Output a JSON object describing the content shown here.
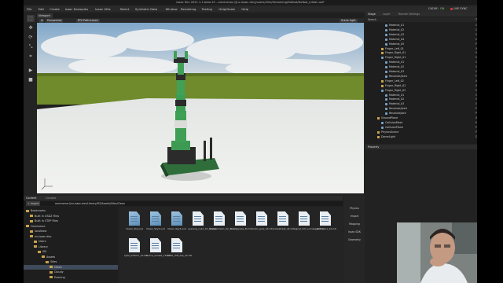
{
  "window": {
    "title": "Isaac Sim 2021.1.1-beta.10 - omniverse://[nv-isaac-dev]/users/hlliu/Streaming/Dofbot/Dofbot_initial.usd*"
  },
  "menu": {
    "items": [
      "File",
      "Edit",
      "Create",
      "Isaac Examples",
      "Isaac Utils",
      "Select",
      "Synthetic Data",
      "Window",
      "Rendering",
      "Testing",
      "Help/Goals",
      "Help"
    ],
    "cache_label": "CACHE:",
    "cache_state": "ON",
    "live_sync": "LIVE SYNC"
  },
  "viewport": {
    "tab": "Viewport",
    "perspective": "Perspective",
    "rtx": "RTX Path-traced",
    "camera": "Scene Light"
  },
  "tools": [
    "select-icon",
    "move-icon",
    "rotate-icon",
    "scale-icon",
    "snap-icon",
    "play-icon",
    "stop-icon"
  ],
  "content": {
    "tabs": [
      "Content",
      "Console"
    ],
    "import_label": "Import",
    "path": "omniverse://nv-isaac-dev/Library/ISS/Assets/Sites/Clean",
    "tree": [
      {
        "label": "Bookmarks",
        "indent": 0
      },
      {
        "label": "Built In USDZ Files",
        "indent": 1
      },
      {
        "label": "Built In STEP Files",
        "indent": 1
      },
      {
        "label": "Omniverse",
        "indent": 0
      },
      {
        "label": "localhost",
        "indent": 1
      },
      {
        "label": "nv-isaac-dev",
        "indent": 1
      },
      {
        "label": "Users",
        "indent": 2
      },
      {
        "label": "Library",
        "indent": 2
      },
      {
        "label": "ISS",
        "indent": 3
      },
      {
        "label": "Assets",
        "indent": 4
      },
      {
        "label": "Sites",
        "indent": 5
      },
      {
        "label": "Clean",
        "indent": 6,
        "selected": true
      },
      {
        "label": "Cloudy",
        "indent": 6
      },
      {
        "label": "Evening",
        "indent": 6
      }
    ],
    "files": [
      {
        "label": "Clean_Sky.usd",
        "kind": "blue"
      },
      {
        "label": "Clean_Sky2.usd",
        "kind": "blue"
      },
      {
        "label": "Clean_Sky3.usd",
        "kind": "blue"
      },
      {
        "label": "evening_road_01_4k.hdr",
        "kind": "white"
      },
      {
        "label": "kloppenheim_02_4k.hdr",
        "kind": "white"
      },
      {
        "label": "noon_grass_4k.hdr",
        "kind": "white"
      },
      {
        "label": "rustic_gras_4k.hdr",
        "kind": "white"
      },
      {
        "label": "snowstreet_4k.hdr",
        "kind": "white"
      },
      {
        "label": "signal_hill_sunrise_4k.hdr",
        "kind": "white"
      },
      {
        "label": "sunflowers_4k.hdr",
        "kind": "white"
      },
      {
        "label": "sylla_bottom_1k.hdr",
        "kind": "white"
      },
      {
        "label": "venice_sunset_1k.hdr",
        "kind": "white"
      },
      {
        "label": "white_cliff_top_1k.hdr",
        "kind": "white"
      }
    ]
  },
  "right_buttons": [
    "Physics",
    "Import",
    "Mapping",
    "Isaac SDK",
    "Geometry"
  ],
  "stage": {
    "tabs": [
      "Stage",
      "Layer",
      "Render Settings"
    ],
    "columns": {
      "name": "Name",
      "type": "Type"
    },
    "search": "Search",
    "rows": [
      {
        "name": "Material_01",
        "type": "GeomSubset",
        "indent": 3,
        "icon": "mesh"
      },
      {
        "name": "Material_02",
        "type": "GeomSubset",
        "indent": 3,
        "icon": "mesh"
      },
      {
        "name": "Material_03",
        "type": "GeomSubset",
        "indent": 3,
        "icon": "mesh"
      },
      {
        "name": "Material_04",
        "type": "GeomSubset",
        "indent": 3,
        "icon": "mesh"
      },
      {
        "name": "Material_05",
        "type": "PhysicsRevolute",
        "indent": 3,
        "icon": "mesh"
      },
      {
        "name": "Finger_Left_01",
        "type": "Xform",
        "indent": 2,
        "icon": "xf"
      },
      {
        "name": "Finger_Right_01",
        "type": "Xform",
        "indent": 2,
        "icon": "xf"
      },
      {
        "name": "Finger_Right_01",
        "type": "Mesh",
        "indent": 2,
        "icon": "mesh"
      },
      {
        "name": "Material_01",
        "type": "GeomSubset",
        "indent": 3,
        "icon": "mesh"
      },
      {
        "name": "Material_02",
        "type": "GeomSubset",
        "indent": 3,
        "icon": "mesh"
      },
      {
        "name": "Material_03",
        "type": "GeomSubset",
        "indent": 3,
        "icon": "mesh"
      },
      {
        "name": "Revolute/Joint",
        "type": "PhysicsRevolute",
        "indent": 3,
        "icon": "mesh"
      },
      {
        "name": "Finger_Left_02",
        "type": "Xform",
        "indent": 2,
        "icon": "xf"
      },
      {
        "name": "Finger_Right_02",
        "type": "Xform",
        "indent": 2,
        "icon": "xf"
      },
      {
        "name": "Finger_Right_02",
        "type": "Mesh",
        "indent": 2,
        "icon": "mesh"
      },
      {
        "name": "Material_01",
        "type": "GeomSubset",
        "indent": 3,
        "icon": "mesh"
      },
      {
        "name": "Material_02",
        "type": "GeomSubset",
        "indent": 3,
        "icon": "mesh"
      },
      {
        "name": "Material_03",
        "type": "GeomSubset",
        "indent": 3,
        "icon": "mesh"
      },
      {
        "name": "Revolute/Joint",
        "type": "PhysicsRevolute",
        "indent": 3,
        "icon": "mesh"
      },
      {
        "name": "RevoluteJoint",
        "type": "PhysicsRevolute",
        "indent": 3,
        "icon": "mesh"
      },
      {
        "name": "GroundPlane",
        "type": "Xform",
        "indent": 1,
        "icon": "xf"
      },
      {
        "name": "CollisionMesh",
        "type": "Mesh",
        "indent": 2,
        "icon": "mesh"
      },
      {
        "name": "CollisionPlane",
        "type": "Plane",
        "indent": 2,
        "icon": "mesh"
      },
      {
        "name": "PhysicsScene",
        "type": "PhysicsScene",
        "indent": 1,
        "icon": "xf"
      },
      {
        "name": "DomeLight",
        "type": "DomeLight",
        "indent": 1,
        "icon": "xf"
      }
    ]
  },
  "properties": {
    "tab": "Property"
  }
}
